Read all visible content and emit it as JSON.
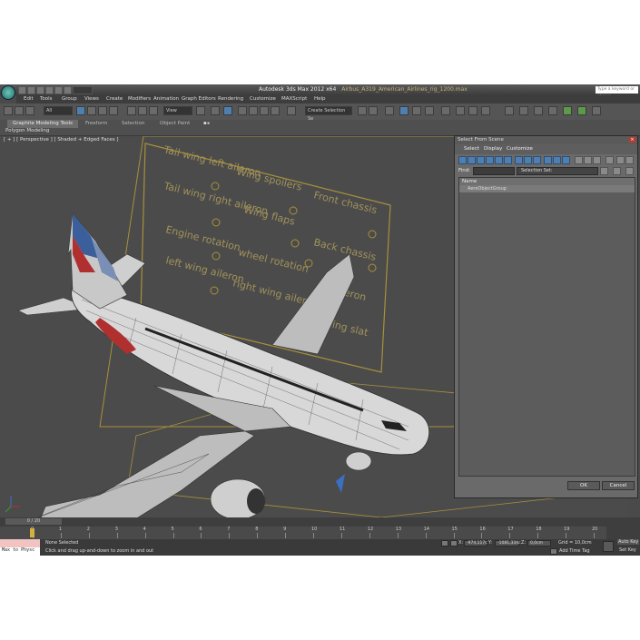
{
  "window": {
    "app_title": "Autodesk 3ds Max  2012 x64",
    "file_name": "Airbus_A319_American_Airlines_rig_1200.max",
    "search_placeholder": "Type a keyword or phrase"
  },
  "menu": [
    "Edit",
    "Tools",
    "Group",
    "Views",
    "Create",
    "Modifiers",
    "Animation",
    "Graph Editors",
    "Rendering",
    "Customize",
    "MAXScript",
    "Help"
  ],
  "toolbar": {
    "selection_filter": "All",
    "reference_coord": "View",
    "named_selection": "Create Selection Se"
  },
  "ribbon": {
    "tabs": [
      "Graphite Modeling Tools",
      "Freeform",
      "Selection",
      "Object Paint"
    ],
    "subpanel": "Polygon Modeling"
  },
  "viewport": {
    "label": "[ + ] [ Perspective ] [ Shaded + Edged Faces ]",
    "rig_controls": [
      "Tail wing left aileron",
      "Tail wing right aileron",
      "Engine rotation",
      "left wing aileron",
      "Wing spoilers",
      "Wing flaps",
      "wheel rotation",
      "right wing aileron",
      "Front chassis",
      "Back chassis",
      "Aileron",
      "Wing slat"
    ],
    "fuselage_color": "#d8d8d8",
    "tail_colors": [
      "#b03030",
      "#3a5f9a",
      "#c0c0c0"
    ]
  },
  "select_from_scene": {
    "title": "Select From Scene",
    "menu": [
      "Select",
      "Display",
      "Customize"
    ],
    "find_label": "Find:",
    "selection_set_label": "Selection Set:",
    "column_header": "Name",
    "rows": [
      "AeroObjectGroup"
    ],
    "ok_label": "OK",
    "cancel_label": "Cancel"
  },
  "timeline": {
    "frame_display": "0 / 20",
    "ticks": [
      "0",
      "1",
      "2",
      "3",
      "4",
      "5",
      "6",
      "7",
      "8",
      "9",
      "10",
      "11",
      "12",
      "13",
      "14",
      "15",
      "16",
      "17",
      "18",
      "19",
      "20"
    ]
  },
  "status": {
    "maxscript_text": "Max to Physc",
    "selection_status": "None Selected",
    "prompt": "Click and drag up-and-down to zoom in and out",
    "x_label": "X:",
    "x_value": "-974,117c",
    "y_label": "Y:",
    "y_value": "-1081,334c",
    "z_label": "Z:",
    "z_value": "0,0cm",
    "grid": "Grid = 10,0cm",
    "auto_key": "Auto Key",
    "set_key": "Set Key",
    "add_time_tag": "Add Time Tag"
  }
}
